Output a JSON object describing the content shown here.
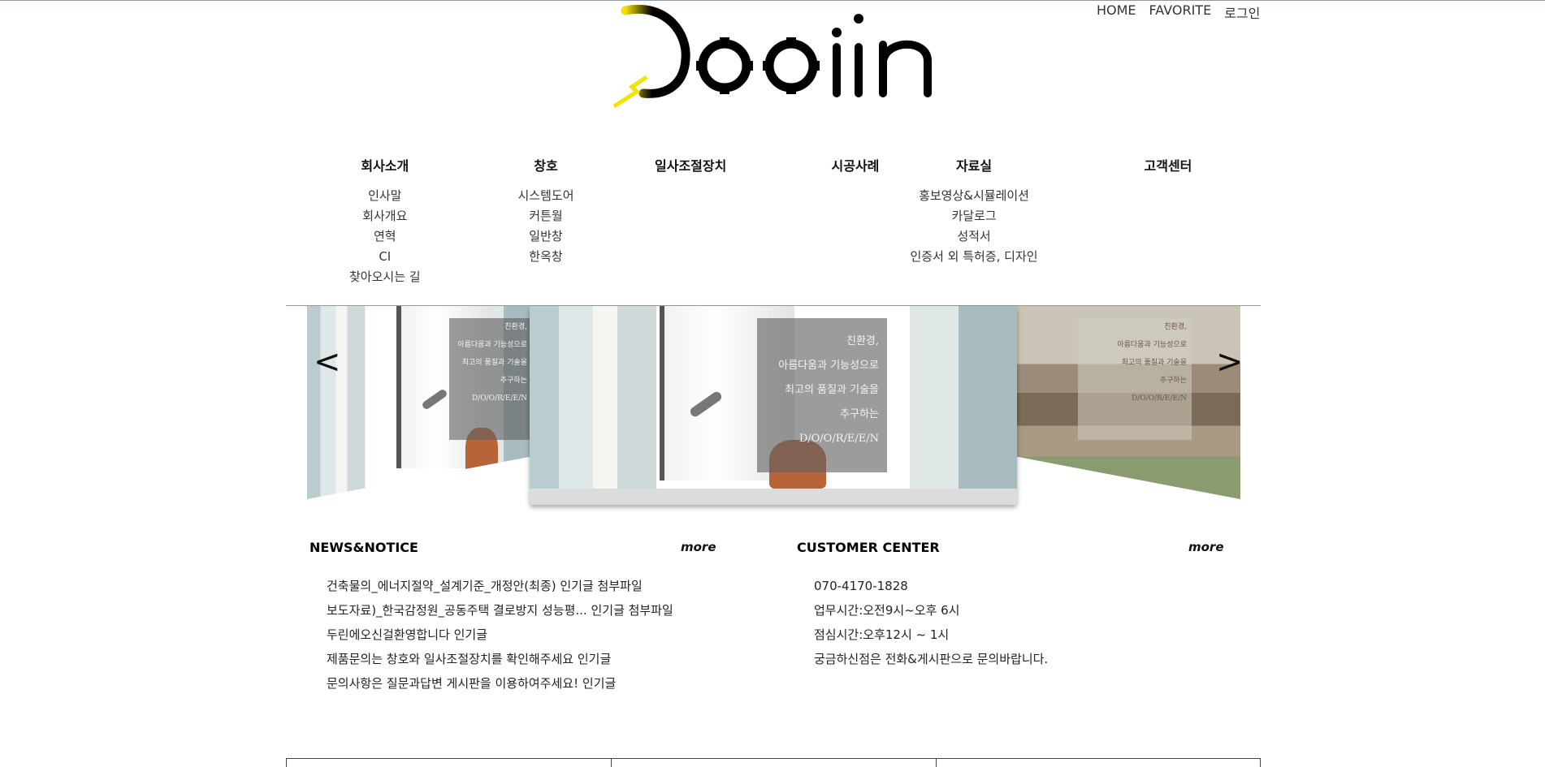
{
  "top_links": [
    "HOME",
    "FAVORITE",
    "로그인"
  ],
  "logo": {
    "text": "Dooiin",
    "accent": "#ffe100"
  },
  "menu": [
    {
      "label": "회사소개",
      "items": [
        "인사말",
        "회사개요",
        "연혁",
        "CI",
        "찾아오시는 길"
      ]
    },
    {
      "label": "창호",
      "items": [
        "시스템도어",
        "커튼월",
        "일반창",
        "한옥창"
      ]
    },
    {
      "label": "일사조절장치",
      "items": []
    },
    {
      "label": "시공사례",
      "items": []
    },
    {
      "label": "자료실",
      "items": [
        "홍보영상&시뮬레이션",
        "카달로그",
        "성적서",
        "인증서 외 특허증, 디자인"
      ]
    },
    {
      "label": "고객센터",
      "items": []
    }
  ],
  "slider": {
    "prev_label": "<",
    "next_label": ">",
    "caption_lines": [
      "친환경,",
      "아름다움과 기능성으로",
      "최고의 품질과 기술을",
      "추구하는",
      "D/O/O/R/E/E/N"
    ]
  },
  "news": {
    "title": "NEWS&NOTICE",
    "more": "more",
    "items": [
      "건축물의_에너지절약_설계기준_개정안(최종) 인기글 첨부파일",
      "보도자료)_한국감정원_공동주택 결로방지 성능평... 인기글 첨부파일",
      "두린에오신걸환영합니다 인기글",
      "제품문의는 창호와 일사조절장치를 확인해주세요 인기글",
      "문의사항은 질문과답변 게시판을 이용하여주세요! 인기글"
    ]
  },
  "customer": {
    "title": "CUSTOMER CENTER",
    "more": "more",
    "items": [
      "070-4170-1828",
      "업무시간:오전9시~오후 6시",
      "점심시간:오후12시 ~ 1시",
      "궁금하신점은 전화&게시판으로 문의바랍니다."
    ]
  }
}
